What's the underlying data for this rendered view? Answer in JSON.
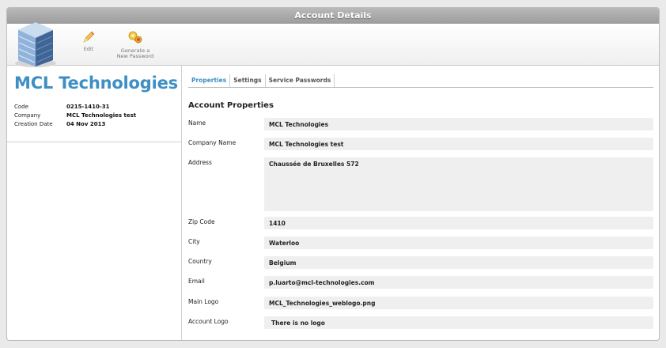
{
  "window": {
    "title": "Account Details"
  },
  "toolbar": {
    "edit_label": "Edit",
    "generate_label_line1": "Generate a",
    "generate_label_line2": "New Password"
  },
  "company": {
    "name": "MCL Technologies",
    "info": [
      {
        "label": "Code",
        "value": "0215-1410-31"
      },
      {
        "label": "Company",
        "value": "MCL Technologies test"
      },
      {
        "label": "Creation Date",
        "value": "04 Nov 2013"
      }
    ]
  },
  "tabs": [
    {
      "label": "Properties",
      "active": true
    },
    {
      "label": "Settings",
      "active": false
    },
    {
      "label": "Service Passwords",
      "active": false
    }
  ],
  "properties": {
    "section_title": "Account Properties",
    "fields": [
      {
        "label": "Name",
        "value": "MCL Technologies"
      },
      {
        "label": "Company Name",
        "value": "MCL Technologies test"
      },
      {
        "label": "Address",
        "value": "Chaussée de Bruxelles 572"
      },
      {
        "label": "Zip Code",
        "value": "1410"
      },
      {
        "label": "City",
        "value": "Waterloo"
      },
      {
        "label": "Country",
        "value": "Belgium"
      },
      {
        "label": "Email",
        "value": "p.luarto@mcl-technologies.com"
      },
      {
        "label": "Main Logo",
        "value": "MCL_Technologies_weblogo.png"
      },
      {
        "label": "Account Logo",
        "value": "There is no logo"
      }
    ]
  },
  "colors": {
    "accent": "#3d8fc4",
    "titlebar": "#a9a9a9",
    "field_bg": "#efefef"
  }
}
